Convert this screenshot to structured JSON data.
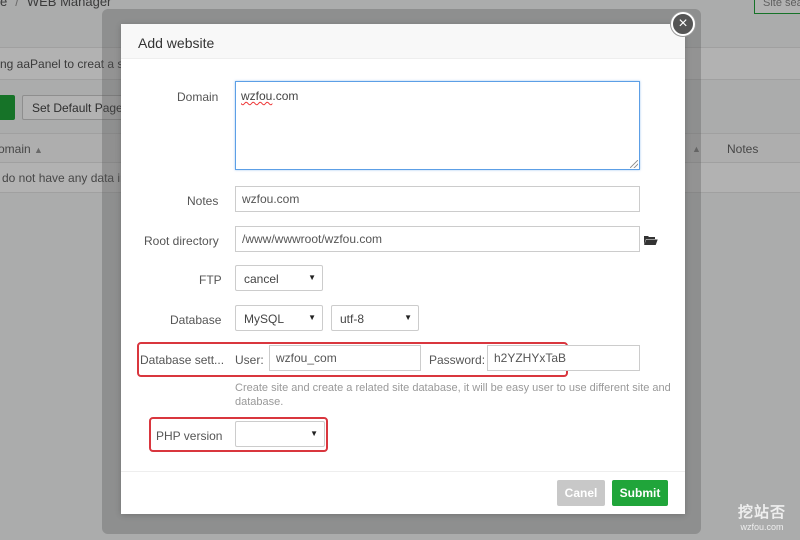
{
  "background": {
    "breadcrumb": [
      "e",
      "WEB Manager"
    ],
    "search_placeholder": "Site sea",
    "notice_text": "ng aaPanel to creat a sit",
    "set_default_page_label": "Set Default Page",
    "table": {
      "col_domain": "omain",
      "col_notes": "Notes",
      "empty_text": "do not have any data in"
    }
  },
  "modal": {
    "title": "Add website",
    "close_glyph": "×",
    "domain": {
      "label": "Domain",
      "value_spell": "wzfou",
      "value_rest": ".com"
    },
    "notes": {
      "label": "Notes",
      "value": "wzfou.com"
    },
    "root_directory": {
      "label": "Root directory",
      "value": "/www/wwwroot/wzfou.com"
    },
    "ftp": {
      "label": "FTP",
      "selected": "cancel"
    },
    "database": {
      "label": "Database",
      "type": "MySQL",
      "charset": "utf-8"
    },
    "database_settings": {
      "label": "Database sett...",
      "user_label": "User:",
      "user_value": "wzfou_com",
      "password_label": "Password:",
      "password_value": "h2YZHYxTaB"
    },
    "help_text": "Create site and create a related site database, it will be easy user to use different site and database.",
    "php_version": {
      "label": "PHP version",
      "selected": ""
    },
    "cancel_label": "Canel",
    "submit_label": "Submit"
  },
  "watermark": {
    "main": "挖站否",
    "sub": "wzfou.com"
  },
  "colors": {
    "accent_green": "#20a53a",
    "highlight_red": "#d9363e",
    "focus_blue": "#5c9fe6"
  },
  "icons": {
    "root_directory_browse": "folder-open-icon",
    "select_caret": "caret-down-icon",
    "sort": "sort-arrow-icon"
  }
}
